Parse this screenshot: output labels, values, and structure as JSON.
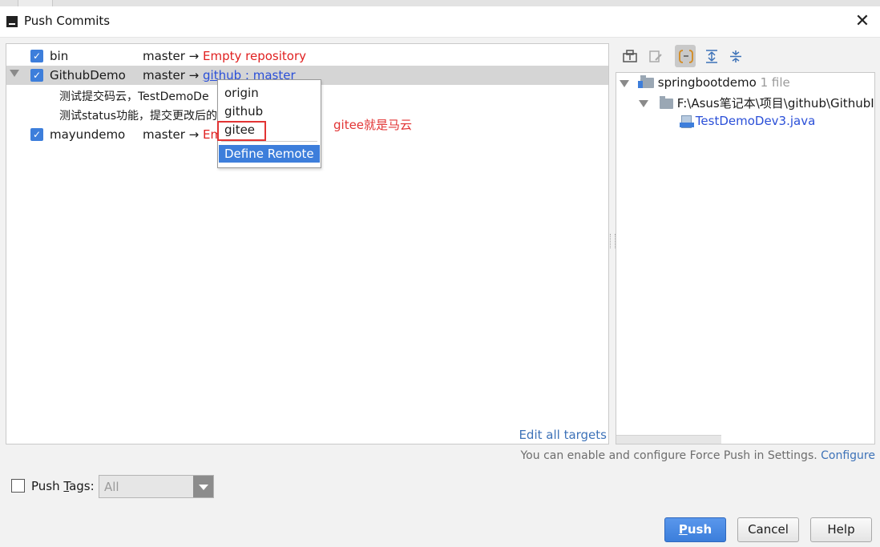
{
  "window": {
    "title": "Push Commits",
    "close_glyph": "✕"
  },
  "repos": [
    {
      "name": "bin",
      "branch": "master →",
      "target": "Empty repository"
    },
    {
      "name": "GithubDemo",
      "branch": "master →",
      "remote": "github",
      "separator": " : ",
      "remote_branch": "master",
      "commits": [
        "测试提交码云，TestDemoDe",
        "测试status功能，提交更改后的"
      ]
    },
    {
      "name": "mayundemo",
      "branch": "master →",
      "target_fragment": "Em"
    }
  ],
  "edit_all_targets": "Edit all targets",
  "remote_popup": {
    "items": [
      "origin",
      "github",
      "gitee"
    ],
    "define_remote": "Define Remote"
  },
  "annotation": "gitee就是马云",
  "toolbar_icons": [
    "view-options-icon",
    "edit-source-icon",
    "group-by-directory-icon",
    "expand-all-icon",
    "collapse-all-icon"
  ],
  "file_tree": {
    "root": "springbootdemo",
    "root_count": "1 file",
    "folder": "F:\\Asus笔记本\\项目\\github\\GithubI",
    "file": "TestDemoDev3.java"
  },
  "hint": {
    "text": "You can enable and configure Force Push in Settings.",
    "link": "Configure"
  },
  "push_tags": {
    "label_prefix": "Push ",
    "label_mnemonic": "T",
    "label_suffix": "ags:",
    "value": "All"
  },
  "buttons": {
    "push_mnemonic": "P",
    "push_rest": "ush",
    "cancel": "Cancel",
    "help": "Help"
  },
  "colors": {
    "accent": "#3d7edb",
    "error_red": "#e02020",
    "link_blue": "#2a4fd8"
  }
}
